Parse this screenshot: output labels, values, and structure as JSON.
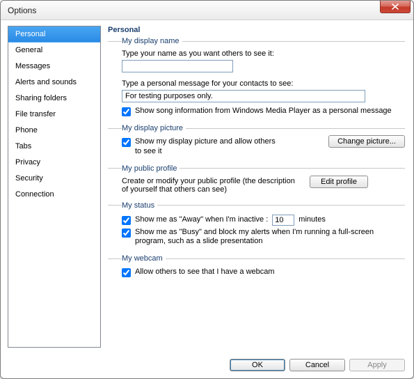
{
  "window": {
    "title": "Options"
  },
  "sidebar": {
    "items": [
      {
        "label": "Personal",
        "selected": true
      },
      {
        "label": "General"
      },
      {
        "label": "Messages"
      },
      {
        "label": "Alerts and sounds"
      },
      {
        "label": "Sharing folders"
      },
      {
        "label": "File transfer"
      },
      {
        "label": "Phone"
      },
      {
        "label": "Tabs"
      },
      {
        "label": "Privacy"
      },
      {
        "label": "Security"
      },
      {
        "label": "Connection"
      }
    ]
  },
  "main": {
    "title": "Personal",
    "display_name": {
      "legend": "My display name",
      "name_label": "Type your name as you want others to see it:",
      "name_value": "",
      "msg_label": "Type a personal message for your contacts to see:",
      "msg_value": "For testing purposes only.",
      "song_checked": true,
      "song_label": "Show song information from Windows Media Player as a personal message"
    },
    "display_picture": {
      "legend": "My display picture",
      "show_checked": true,
      "show_label": "Show my display picture and allow others to see it",
      "change_btn": "Change picture..."
    },
    "public_profile": {
      "legend": "My public profile",
      "desc": "Create or modify your public profile (the description of yourself that others can see)",
      "edit_btn": "Edit profile"
    },
    "status": {
      "legend": "My status",
      "away_checked": true,
      "away_label_pre": "Show me as \"Away\" when I'm inactive :",
      "away_minutes": "10",
      "away_label_post": "minutes",
      "busy_checked": true,
      "busy_label": "Show me as \"Busy\" and block my alerts when I'm running a full-screen program, such as a slide presentation"
    },
    "webcam": {
      "legend": "My webcam",
      "allow_checked": true,
      "allow_label": "Allow others to see that I have a webcam"
    }
  },
  "footer": {
    "ok": "OK",
    "cancel": "Cancel",
    "apply": "Apply",
    "apply_disabled": true
  }
}
